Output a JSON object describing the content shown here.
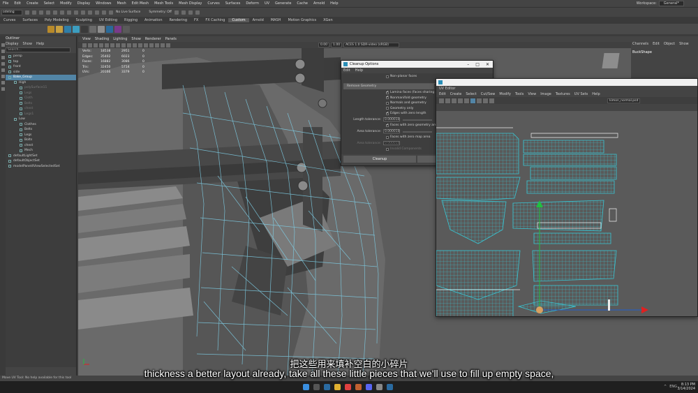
{
  "menubar": {
    "items": [
      "File",
      "Edit",
      "Create",
      "Select",
      "Modify",
      "Display",
      "Windows",
      "Mesh",
      "Edit Mesh",
      "Mesh Tools",
      "Mesh Display",
      "Curves",
      "Surfaces",
      "Deform",
      "UV",
      "Generate",
      "Cache",
      "Arnold",
      "Help"
    ],
    "workspace_label": "Workspace:",
    "workspace_value": "General*"
  },
  "statusline": {
    "mode_value": "odeling",
    "live_surface": "No Live Surface",
    "symmetry": "Symmetry: Off"
  },
  "shelf_tabs": [
    "Curves",
    "Surfaces",
    "Poly Modeling",
    "Sculpting",
    "UV Editing",
    "Rigging",
    "Animation",
    "Rendering",
    "FX",
    "FX Caching",
    "Custom",
    "Arnold",
    "MASH",
    "Motion Graphics",
    "XGen"
  ],
  "shelf_active_tab": "Custom",
  "outliner": {
    "title": "Outliner",
    "menu": [
      "Display",
      "Show",
      "Help"
    ],
    "search_placeholder": "Search...",
    "items": [
      {
        "label": "persp",
        "state": "normal"
      },
      {
        "label": "top",
        "state": "normal"
      },
      {
        "label": "front",
        "state": "normal"
      },
      {
        "label": "side",
        "state": "normal"
      },
      {
        "label": "Bake_Group",
        "state": "selected"
      },
      {
        "label": "High",
        "state": "normal"
      },
      {
        "label": "polySurface11",
        "state": "dim"
      },
      {
        "label": "Legs",
        "state": "dim"
      },
      {
        "label": "Cloth",
        "state": "dim"
      },
      {
        "label": "Belts",
        "state": "dim"
      },
      {
        "label": "chest",
        "state": "dim"
      },
      {
        "label": "Legs1",
        "state": "dim"
      },
      {
        "label": "Low",
        "state": "normal"
      },
      {
        "label": "Clothes",
        "state": "normal"
      },
      {
        "label": "Belts",
        "state": "normal"
      },
      {
        "label": "Legs",
        "state": "normal"
      },
      {
        "label": "Bolts",
        "state": "normal"
      },
      {
        "label": "chest",
        "state": "normal"
      },
      {
        "label": "Mech",
        "state": "normal"
      },
      {
        "label": "defaultLightSet",
        "state": "normal"
      },
      {
        "label": "defaultObjectSet",
        "state": "normal"
      },
      {
        "label": "modelPanel4ViewSelectedSet",
        "state": "normal"
      }
    ]
  },
  "viewport": {
    "menu": [
      "View",
      "Shading",
      "Lighting",
      "Show",
      "Renderer",
      "Panels"
    ],
    "near_value": "0.00",
    "far_value": "1.00",
    "colorspace": "ACES 1.0 SDR-video (sRGB)",
    "hud": [
      {
        "label": "Verts:",
        "a": "18538",
        "b": "2951",
        "c": "0"
      },
      {
        "label": "Edges:",
        "a": "35402",
        "b": "6023",
        "c": "0"
      },
      {
        "label": "Faces:",
        "a": "16882",
        "b": "3086",
        "c": "0"
      },
      {
        "label": "Tris:",
        "a": "32450",
        "b": "5714",
        "c": "0"
      },
      {
        "label": "UVs:",
        "a": "20166",
        "b": "3379",
        "c": "0"
      }
    ]
  },
  "cleanup_dialog": {
    "title": "Cleanup Options",
    "menu": [
      "Edit",
      "Help"
    ],
    "top_check": "Non-planar faces",
    "section": "Remove Geometry",
    "checks": [
      {
        "label": "Lamina faces (faces sharing all e...",
        "on": true,
        "dim": false
      },
      {
        "label": "Nonmanifold geometry",
        "on": true,
        "dim": false
      },
      {
        "label": "Normals and geometry",
        "on": false,
        "dim": false
      },
      {
        "label": "Geometry only",
        "on": false,
        "dim": false
      },
      {
        "label": "Edges with zero length",
        "on": true,
        "dim": false
      }
    ],
    "length_tolerance_label": "Length tolerance:",
    "length_tolerance_value": "0.000010",
    "zero_area_check": "Faces with zero geometry area",
    "area_tolerance_label": "Area tolerance:",
    "area_tolerance_value": "0.000010",
    "zero_map_check": "Faces with zero map area",
    "area_tolerance2_label": "Area tolerance:",
    "area_tolerance2_value": "0.000010",
    "invalid_check": "Invalid Components",
    "cleanup_button": "Cleanup",
    "apply_button": "Apply"
  },
  "uv_editor": {
    "title": "UV Editor",
    "menu": [
      "Edit",
      "Create",
      "Select",
      "Cut/Sew",
      "Modify",
      "Tools",
      "View",
      "Image",
      "Textures",
      "UV Sets",
      "Help"
    ],
    "texture_name": "kimon_normal.psd"
  },
  "channel_box": {
    "menu": [
      "Channels",
      "Edit",
      "Object",
      "Show"
    ],
    "object_name": "BuckShape"
  },
  "helpline": "Move UV Tool: No help available for this tool",
  "taskbar": {
    "time": "8:13 PM",
    "date": "3/14/2024",
    "lang": "ENG"
  },
  "subtitles": {
    "chinese": "把这些用来填补空白的小碎片",
    "english": "thickness a better layout already, take all these little pieces that we'll use to fill up empty space,"
  },
  "colors": {
    "maya_bg": "#444444",
    "selection_blue": "#5285a6",
    "uv_wire": "#38c8d6",
    "mesh_wire": "#7fd0e8",
    "x_axis": "#e02020",
    "y_axis": "#20c040"
  }
}
